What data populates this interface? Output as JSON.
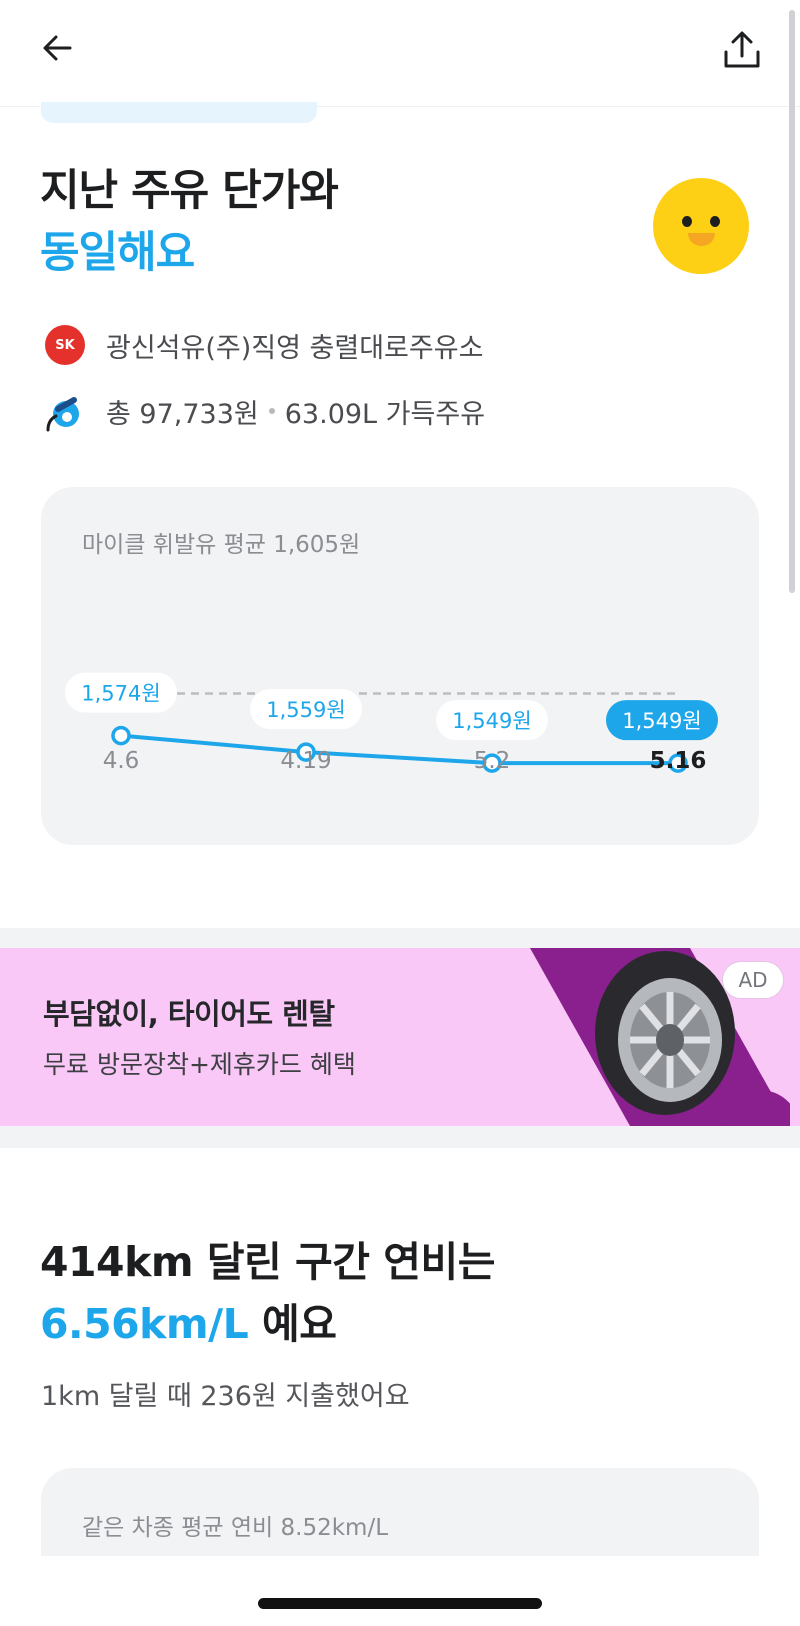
{
  "header": {
    "back_icon": "arrow-left-icon",
    "share_icon": "share-upload-icon"
  },
  "summary": {
    "headline_line1": "지난 주유 단가와",
    "headline_line2": "동일해요",
    "station_logo": "SK",
    "station_name": "광신석유(주)직영 충렬대로주유소",
    "total_amount": "총 97,733원",
    "liters": "63.09L 가득주유",
    "accent_color": "#1ea6ea"
  },
  "chart_data": {
    "type": "line",
    "title": "마이클 휘발유 평균 1,605원",
    "categories": [
      "4.6",
      "4.19",
      "5.2",
      "5.16"
    ],
    "values": [
      1574,
      1559,
      1549,
      1549
    ],
    "data_labels": [
      "1,574원",
      "1,559원",
      "1,549원",
      "1,549원"
    ],
    "highlighted_index": 3,
    "reference_line": 1605,
    "ylim": [
      1520,
      1620
    ],
    "grid": false
  },
  "ad": {
    "title": "부담없이, 타이어도 렌탈",
    "subtitle": "무료 방문장착+제휴카드 혜택",
    "badge": "AD"
  },
  "efficiency": {
    "line1": "414km 달린 구간 연비는",
    "value": "6.56km/L",
    "suffix": " 예요",
    "cost_per_km": "1km 달릴 때 236원 지출했어요",
    "comparison_title": "같은 차종 평균 연비 8.52km/L"
  }
}
